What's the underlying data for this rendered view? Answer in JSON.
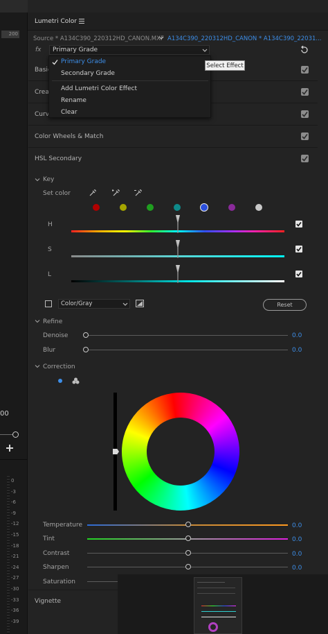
{
  "panel": {
    "title": "Lumetri Color",
    "source_label": "Source * A134C390_220312HD_CANON.MXF",
    "target_label": "A134C390_220312HD_CANON * A134C390_22031..."
  },
  "fx": {
    "label": "fx",
    "selected": "Primary Grade"
  },
  "menu": {
    "items": [
      "Primary Grade",
      "Secondary Grade",
      "Add Lumetri Color Effect",
      "Rename",
      "Clear"
    ],
    "checked": "Primary Grade"
  },
  "tooltip": "Select Effect",
  "sections": {
    "basic": "Basic",
    "creative": "Creat",
    "curves": "Curve",
    "wheels": "Color Wheels & Match",
    "hsl": "HSL Secondary"
  },
  "key": {
    "title": "Key",
    "set_color": "Set color",
    "swatch_colors": [
      "#b10000",
      "#a4a400",
      "#1f9e1f",
      "#0e8a8a",
      "#2b4fdc",
      "#8a2a9a",
      "#c8c8c8"
    ],
    "h_label": "H",
    "s_label": "S",
    "l_label": "L",
    "mode": "Color/Gray",
    "reset": "Reset"
  },
  "refine": {
    "title": "Refine",
    "denoise_label": "Denoise",
    "denoise_value": "0.0",
    "blur_label": "Blur",
    "blur_value": "0.0"
  },
  "correction": {
    "title": "Correction",
    "temperature_label": "Temperature",
    "temperature_value": "0.0",
    "tint_label": "Tint",
    "tint_value": "0.0",
    "contrast_label": "Contrast",
    "contrast_value": "0.0",
    "sharpen_label": "Sharpen",
    "sharpen_value": "0.0",
    "saturation_label": "Saturation"
  },
  "vignette": "Vignette",
  "left_panel": {
    "ruler_value": "200",
    "timecode_value": "00",
    "add_icon": "plus-icon",
    "meter_labels": [
      "0",
      "-3",
      "-6",
      "-9",
      "-12",
      "-15",
      "-18",
      "-21",
      "-24",
      "-27",
      "-30",
      "-33",
      "-36",
      "-39"
    ]
  },
  "colors": {
    "accent_blue": "#3d8ee8",
    "panel_bg": "#232323"
  }
}
